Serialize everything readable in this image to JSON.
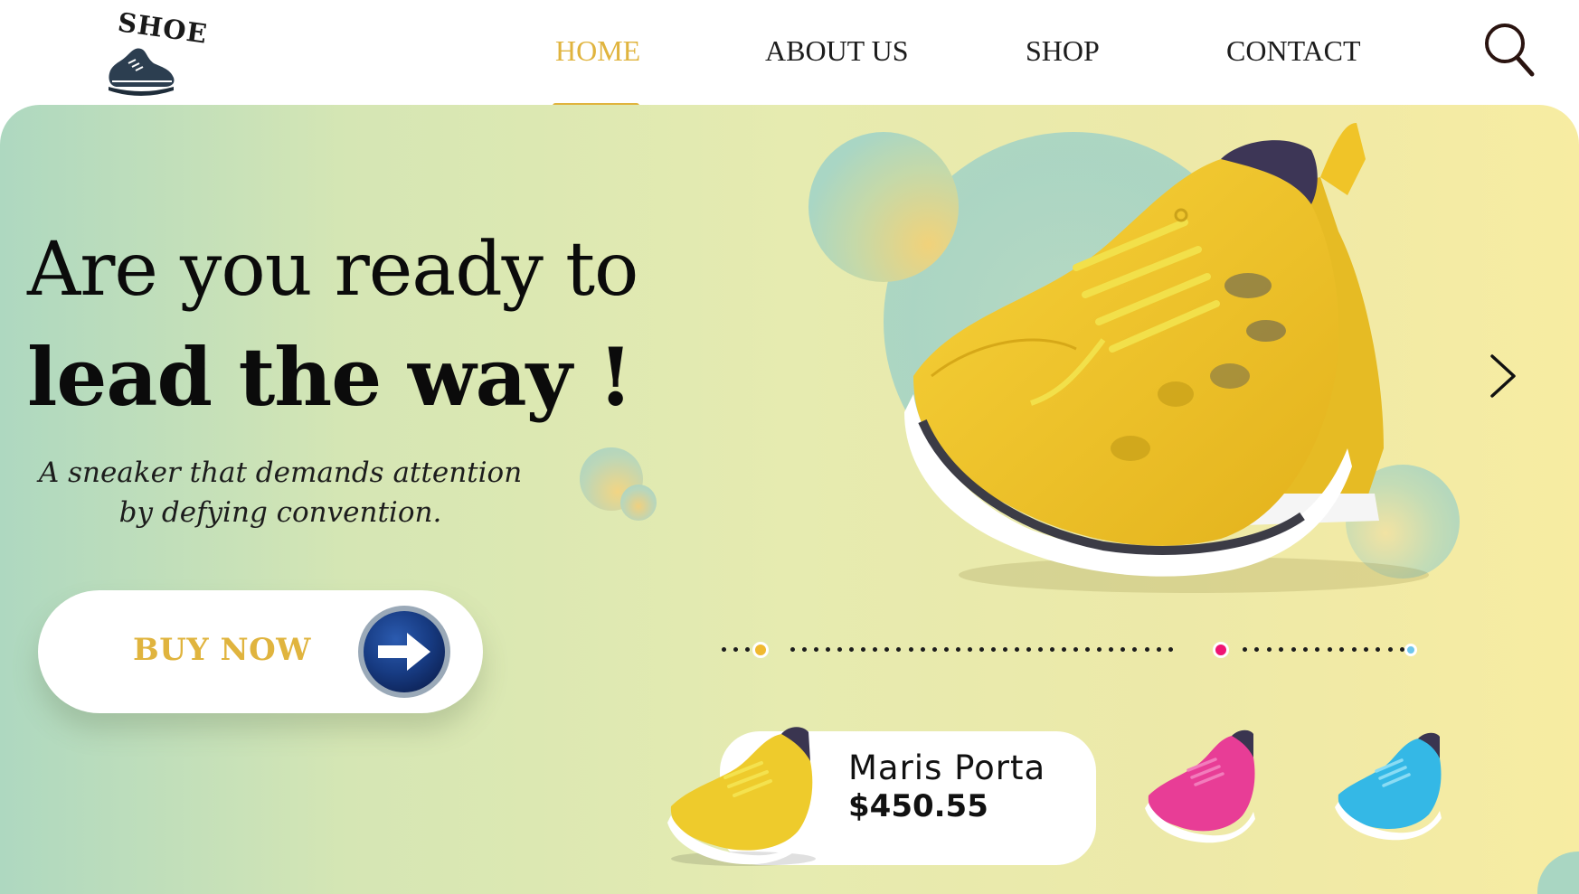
{
  "brand": {
    "logo_text": "SHOE",
    "icon": "shoe-logo-icon"
  },
  "nav": {
    "items": [
      {
        "label": "HOME",
        "active": true
      },
      {
        "label": "ABOUT US",
        "active": false
      },
      {
        "label": "SHOP",
        "active": false
      },
      {
        "label": "CONTACT",
        "active": false
      }
    ],
    "search_icon": "search-icon"
  },
  "hero": {
    "headline_line1": "Are you ready to",
    "headline_line2": "lead the way !",
    "tagline_line1": "A sneaker that demands attention",
    "tagline_line2": "by defying convention.",
    "cta_label": "BUY NOW",
    "cta_icon": "arrow-right-icon",
    "next_icon": "chevron-right-icon"
  },
  "product": {
    "name": "Maris Porta",
    "price": "$450.55",
    "variants": [
      "yellow",
      "pink",
      "blue"
    ]
  },
  "carousel": {
    "total_slides": 3,
    "active_index": 0
  },
  "colors": {
    "accent": "#e0b43e",
    "text": "#111111",
    "dot_active": "#f0b930",
    "dot_pink": "#ef1573",
    "dot_blue": "#6ec6ec",
    "cta_arrow": "#1b3f86"
  }
}
